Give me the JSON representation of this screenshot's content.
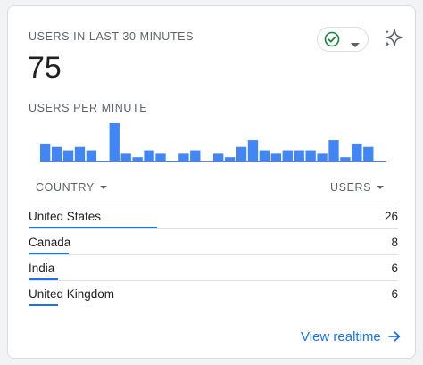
{
  "card": {
    "header_label": "USERS IN LAST 30 MINUTES",
    "total_users": "75",
    "per_minute_label": "USERS PER MINUTE",
    "status_icon": "check-circle-icon",
    "insights_icon": "sparkle-icon"
  },
  "chart_data": {
    "type": "bar",
    "title": "",
    "values": [
      5,
      4,
      3,
      4,
      3,
      0,
      11,
      2,
      1,
      3,
      2,
      0,
      2,
      3,
      0,
      2,
      1,
      4,
      6,
      3,
      2,
      3,
      3,
      3,
      2,
      6,
      1,
      5,
      4,
      0
    ],
    "color": "#4285f4"
  },
  "table": {
    "col_country": "COUNTRY",
    "col_users": "USERS",
    "max_value": 26,
    "rows": [
      {
        "country": "United States",
        "users": "26",
        "share": 1.0
      },
      {
        "country": "Canada",
        "users": "8",
        "share": 0.31
      },
      {
        "country": "India",
        "users": "6",
        "share": 0.23
      },
      {
        "country": "United Kingdom",
        "users": "6",
        "share": 0.23
      }
    ]
  },
  "footer": {
    "link_label": "View realtime"
  },
  "colors": {
    "accent": "#1a73e8",
    "bar": "#4285f4",
    "success": "#188038"
  }
}
